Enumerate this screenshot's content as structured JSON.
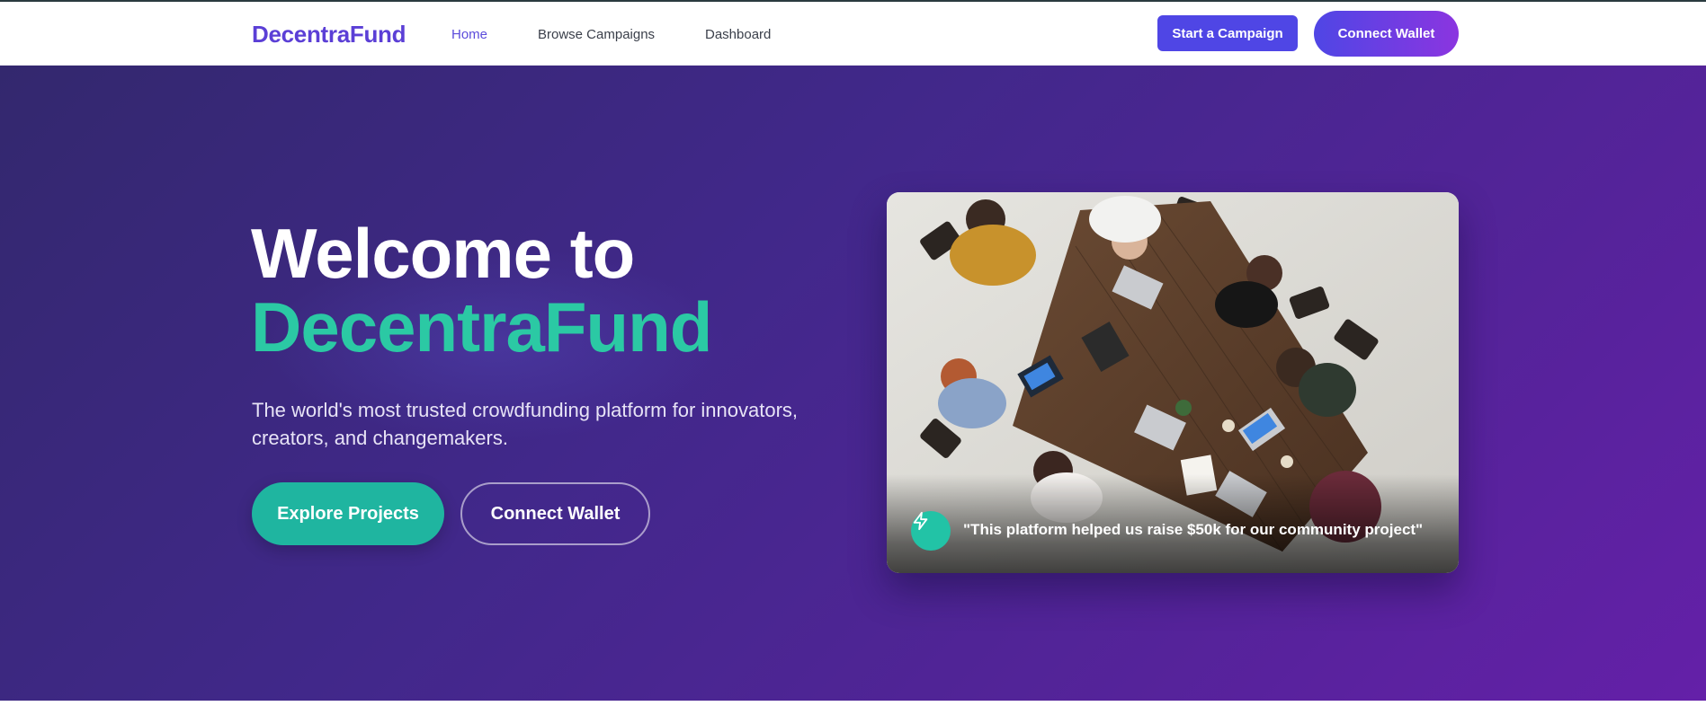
{
  "header": {
    "brand": "DecentraFund",
    "nav": [
      {
        "label": "Home",
        "active": true
      },
      {
        "label": "Browse Campaigns",
        "active": false
      },
      {
        "label": "Dashboard",
        "active": false
      }
    ],
    "start_campaign_label": "Start a Campaign",
    "connect_wallet_label": "Connect Wallet"
  },
  "hero": {
    "title_line1": "Welcome to",
    "title_line2": "DecentraFund",
    "subtitle": "The world's most trusted crowdfunding platform for innovators, creators, and changemakers.",
    "explore_label": "Explore Projects",
    "connect_wallet_label": "Connect Wallet"
  },
  "testimonial": {
    "icon": "lightning-bolt-icon",
    "quote": "\"This platform helped us raise $50k for our community project\""
  },
  "colors": {
    "brand": "#5b3fd6",
    "accent_teal": "#2bc9a4",
    "primary_button": "#4f46e5",
    "hero_gradient_start": "#33286e",
    "hero_gradient_end": "#6420a8"
  }
}
